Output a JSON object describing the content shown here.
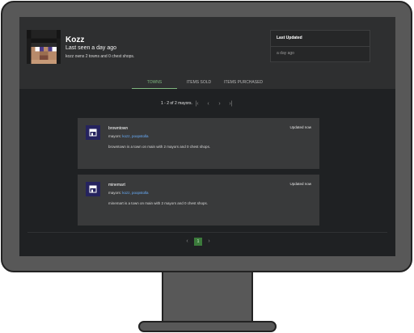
{
  "profile": {
    "name": "Kozz",
    "last_seen": "Last seen a day ago",
    "summary": "kozz owns 2 towns and 0 chest shops."
  },
  "last_updated": {
    "title": "Last Updated",
    "value": "a day ago"
  },
  "tabs": [
    {
      "label": "TOWNS",
      "active": true
    },
    {
      "label": "ITEMS SOLD",
      "active": false
    },
    {
      "label": "ITEMS PURCHASED",
      "active": false
    }
  ],
  "pagination": {
    "range_text": "1 - 2 of 2 mayors.",
    "current_page": "1"
  },
  "towns": [
    {
      "name": "browntown",
      "updated": "Updated now",
      "mayors_label": "mayors:",
      "mayors": "kozz, poopstolla",
      "description": "browntown is a town on main with 2 mayors and 0 chest shops."
    },
    {
      "name": "minemart",
      "updated": "Updated now",
      "mayors_label": "mayors:",
      "mayors": "kozz, poopstolla",
      "description": "minemart is a town on main with 2 mayors and 0 chest shops."
    }
  ],
  "colors": {
    "accent": "#7fb77f",
    "link": "#6ab0ff",
    "icon_bg": "#25235e"
  }
}
